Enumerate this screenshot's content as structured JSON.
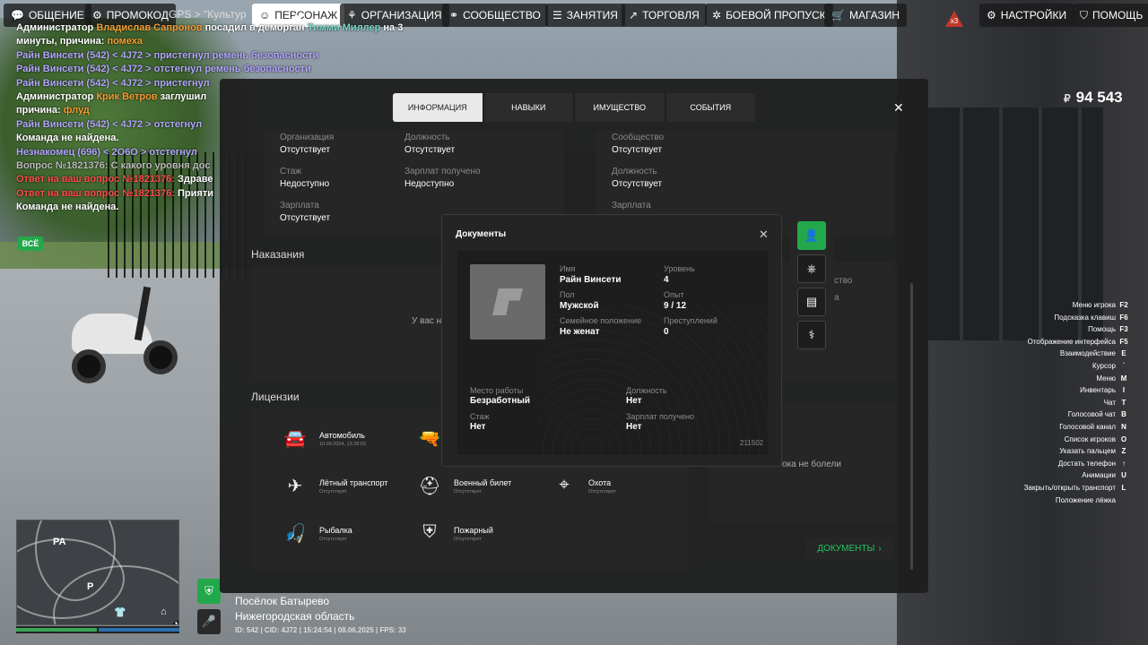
{
  "topbar": {
    "items": [
      {
        "label": "ОБЩЕНИЕ",
        "icon": "chat-icon"
      },
      {
        "label": "ПРОМОКОД",
        "icon": "ticket-icon"
      },
      {
        "label": "ПЕРСОНАЖ",
        "icon": "user-icon"
      },
      {
        "label": "ОРГАНИЗАЦИЯ",
        "icon": "organization-icon"
      },
      {
        "label": "СООБЩЕСТВО",
        "icon": "community-icon"
      },
      {
        "label": "ЗАНЯТИЯ",
        "icon": "list-icon"
      },
      {
        "label": "ТОРГОВЛЯ",
        "icon": "chart-icon"
      },
      {
        "label": "БОЕВОЙ ПРОПУСК",
        "icon": "battlepass-icon"
      },
      {
        "label": "МАГАЗИН",
        "icon": "cart-icon"
      },
      {
        "label": "НАСТРОЙКИ",
        "icon": "gear-icon"
      },
      {
        "label": "ПОМОЩЬ",
        "icon": "help-icon"
      }
    ],
    "gps": "GPS > \"Культур",
    "active": "ПЕРСОНАЖ"
  },
  "hud": {
    "money_symbol": "₽",
    "money": "94 543",
    "badge": "x3"
  },
  "chat": {
    "lines": [
      [
        {
          "t": "Администратор ",
          "c": "white"
        },
        {
          "t": "Владислав Сапронов",
          "c": "orange"
        },
        {
          "t": " посадил в деморган ",
          "c": "white"
        },
        {
          "t": "Тимми Миллер",
          "c": "teal"
        },
        {
          "t": " на 3",
          "c": "white"
        }
      ],
      [
        {
          "t": "минуты, причина: ",
          "c": "white"
        },
        {
          "t": "помеха",
          "c": "orange"
        }
      ],
      [
        {
          "t": "Райн Винсети (542) < 4J72 > пристегнул ремень безопасности",
          "c": "purple"
        }
      ],
      [
        {
          "t": "Райн Винсети (542) < 4J72 > отстегнул ремень безопасности",
          "c": "purple"
        }
      ],
      [
        {
          "t": "Райн Винсети (542) < 4J72 > пристегнул",
          "c": "purple"
        }
      ],
      [
        {
          "t": "Администратор ",
          "c": "white"
        },
        {
          "t": "Крик Ветров",
          "c": "orange"
        },
        {
          "t": " заглушил",
          "c": "white"
        }
      ],
      [
        {
          "t": "причина: ",
          "c": "white"
        },
        {
          "t": "флуд",
          "c": "orange"
        }
      ],
      [
        {
          "t": "Райн Винсети (542) < 4J72 > отстегнул",
          "c": "purple"
        }
      ],
      [
        {
          "t": "Команда не найдена.",
          "c": "white"
        }
      ],
      [
        {
          "t": "Незнакомец (696) < 2O6O > отстегнул",
          "c": "purple"
        }
      ],
      [
        {
          "t": "Вопрос №1821376: С какого уровня дос",
          "c": "gray"
        }
      ],
      [
        {
          "t": "Ответ на ваш вопрос №1821376: ",
          "c": "red"
        },
        {
          "t": "Здраве",
          "c": "white"
        }
      ],
      [
        {
          "t": "Ответ на ваш вопрос №1821376: ",
          "c": "red"
        },
        {
          "t": "Прияти",
          "c": "white"
        }
      ],
      [
        {
          "t": "Команда не найдена.",
          "c": "white"
        }
      ]
    ],
    "all_button": "ВСЁ"
  },
  "hints": [
    {
      "label": "Меню игрока",
      "key": "F2"
    },
    {
      "label": "Подсказка клавиш",
      "key": "F6"
    },
    {
      "label": "Помощь",
      "key": "F3"
    },
    {
      "label": "Отображение интерфейса",
      "key": "F5"
    },
    {
      "label": "Взаимодействие",
      "key": "E"
    },
    {
      "label": "Курсор",
      "key": "`"
    },
    {
      "label": "Меню",
      "key": "M"
    },
    {
      "label": "Инвентарь",
      "key": "I"
    },
    {
      "label": "Чат",
      "key": "T"
    },
    {
      "label": "Голосовой чат",
      "key": "B"
    },
    {
      "label": "Голосовой канал",
      "key": "N"
    },
    {
      "label": "Список игроков",
      "key": "O"
    },
    {
      "label": "Указать пальцем",
      "key": "Z"
    },
    {
      "label": "Достать телефон",
      "key": "↑"
    },
    {
      "label": "Анимации",
      "key": "U"
    },
    {
      "label": "Закрыть/открыть транспорт",
      "key": "L"
    },
    {
      "label": "Положение лёжка",
      "key": ""
    }
  ],
  "location": {
    "village": "Посёлок Батырево",
    "region": "Нижегородская область",
    "info": "ID: 542 | CID: 4J72 | 15:24:54 | 08.06.2025 | FPS: 33"
  },
  "minimap": {
    "label_pa": "PA"
  },
  "panel": {
    "tabs": [
      "ИНФОРМАЦИЯ",
      "НАВЫКИ",
      "ИМУЩЕСТВО",
      "СОБЫТИЯ"
    ],
    "org": {
      "organization_label": "Организация",
      "organization": "Отсутствует",
      "position_label": "Должность",
      "position": "Отсутствует",
      "tenure_label": "Стаж",
      "tenure": "Недоступно",
      "salary_got_label": "Зарплат получено",
      "salary_got": "Недоступно",
      "salary_label": "Зарплата",
      "salary": "Отсутствует"
    },
    "community": {
      "community_label": "Сообщество",
      "community": "Отсутствует",
      "position_label": "Должность",
      "position": "Отсутствует",
      "salary_label": "Зарплата"
    },
    "punishments_title": "Наказания",
    "punishments_text": "У вас н",
    "partial_right_1": "ство",
    "partial_right_2": "а",
    "illness_text": "ока не болели",
    "licenses_title": "Лицензии",
    "licenses": [
      {
        "name": "Автомобиль",
        "sub": "10.09.2024, 13:28:03",
        "icon": "car-icon",
        "glyph": "🚘"
      },
      {
        "name": "",
        "sub": "",
        "icon": "gun-icon",
        "glyph": "🔫"
      },
      {
        "name": "Лётный транспорт",
        "sub": "Отсутствует",
        "icon": "plane-icon",
        "glyph": "✈"
      },
      {
        "name": "Военный билет",
        "sub": "Отсутствует",
        "icon": "helmet-icon",
        "glyph": "⛑"
      },
      {
        "name": "Охота",
        "sub": "Отсутствует",
        "icon": "target-icon",
        "glyph": "⌖"
      },
      {
        "name": "Рыбалка",
        "sub": "Отсутствует",
        "icon": "fishing-icon",
        "glyph": "🎣"
      },
      {
        "name": "Пожарный",
        "sub": "Отсутствует",
        "icon": "fire-icon",
        "glyph": "⛨"
      }
    ],
    "docs_button": "ДОКУМЕНТЫ"
  },
  "documents": {
    "title": "Документы",
    "name_label": "Имя",
    "name": "Райн Винсети",
    "level_label": "Уровень",
    "level": "4",
    "sex_label": "Пол",
    "sex": "Мужской",
    "exp_label": "Опыт",
    "exp": "9 / 12",
    "family_label": "Семейное положение",
    "family": "Не женат",
    "crimes_label": "Преступлений",
    "crimes": "0",
    "work_label": "Место работы",
    "work": "Безработный",
    "position_label": "Должность",
    "position": "Нет",
    "tenure_label": "Стаж",
    "tenure": "Нет",
    "salary_label": "Зарплат получено",
    "salary": "Нет",
    "number": "211502"
  },
  "colors": {
    "accent": "#22a84a",
    "panel": "#1e1e1e",
    "card": "#262626"
  }
}
